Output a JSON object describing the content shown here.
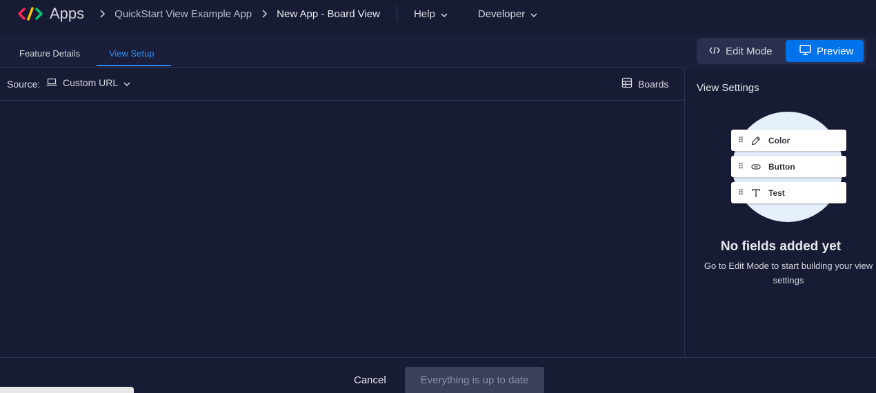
{
  "header": {
    "app_title": "Apps",
    "breadcrumbs": [
      "QuickStart View Example App",
      "New App - Board View"
    ],
    "nav": [
      {
        "label": "Help"
      },
      {
        "label": "Developer"
      }
    ]
  },
  "tabs": [
    {
      "label": "Feature Details",
      "active": false
    },
    {
      "label": "View Setup",
      "active": true
    }
  ],
  "mode_toggle": {
    "edit_label": "Edit Mode",
    "preview_label": "Preview",
    "selected": "Preview"
  },
  "source_bar": {
    "label": "Source:",
    "selected": "Custom URL",
    "boards_label": "Boards"
  },
  "view_settings": {
    "title": "View Settings",
    "illustration_fields": [
      {
        "label": "Color",
        "icon": "pencil-icon"
      },
      {
        "label": "Button",
        "icon": "link-icon"
      },
      {
        "label": "Test",
        "icon": "text-icon"
      }
    ],
    "empty_title": "No fields added yet",
    "empty_desc": "Go to Edit Mode to start building your view settings"
  },
  "footer": {
    "cancel_label": "Cancel",
    "status_label": "Everything is up to date"
  },
  "colors": {
    "background": "#181b34",
    "accent": "#0073ea",
    "active_tab": "#2f8cf0",
    "logo_red": "#fb275d",
    "logo_yellow": "#ffcb00",
    "logo_green": "#00ca72"
  }
}
